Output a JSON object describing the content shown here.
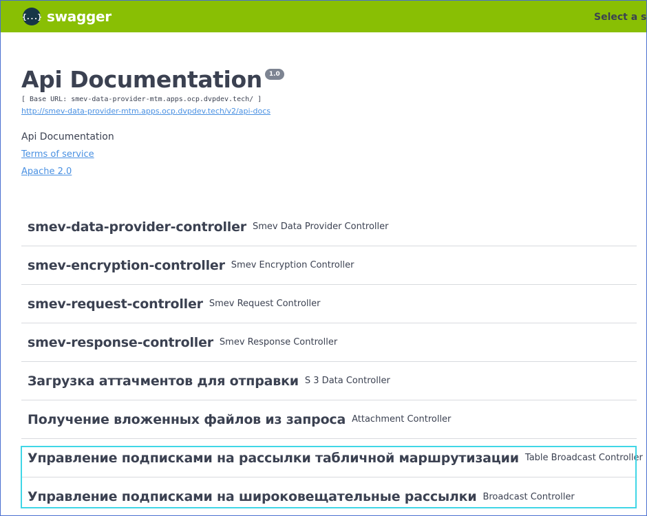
{
  "topbar": {
    "logo_icon": "{...}",
    "logo_text": "swagger",
    "spec_label": "Select a spec"
  },
  "info": {
    "title": "Api Documentation",
    "version": "1.0",
    "base_url": "[ Base URL: smev-data-provider-mtm.apps.ocp.dvpdev.tech/ ]",
    "api_docs_url": "http://smev-data-provider-mtm.apps.ocp.dvpdev.tech/v2/api-docs",
    "description": "Api Documentation",
    "terms_link": "Terms of service",
    "license_link": "Apache 2.0"
  },
  "controllers": [
    {
      "name": "smev-data-provider-controller",
      "description": "Smev Data Provider Controller"
    },
    {
      "name": "smev-encryption-controller",
      "description": "Smev Encryption Controller"
    },
    {
      "name": "smev-request-controller",
      "description": "Smev Request Controller"
    },
    {
      "name": "smev-response-controller",
      "description": "Smev Response Controller"
    },
    {
      "name": "Загрузка аттачментов для отправки",
      "description": "S 3 Data Controller"
    },
    {
      "name": "Получение вложенных файлов из запроса",
      "description": "Attachment Controller"
    },
    {
      "name": "Управление подписками на рассылки табличной маршрутизации",
      "description": "Table Broadcast Controller"
    },
    {
      "name": "Управление подписками на широковещательные рассылки",
      "description": "Broadcast Controller"
    }
  ],
  "colors": {
    "topbar": "#89bf04",
    "text": "#3b4151",
    "link": "#4990e2",
    "highlight": "#3fd6e6"
  }
}
